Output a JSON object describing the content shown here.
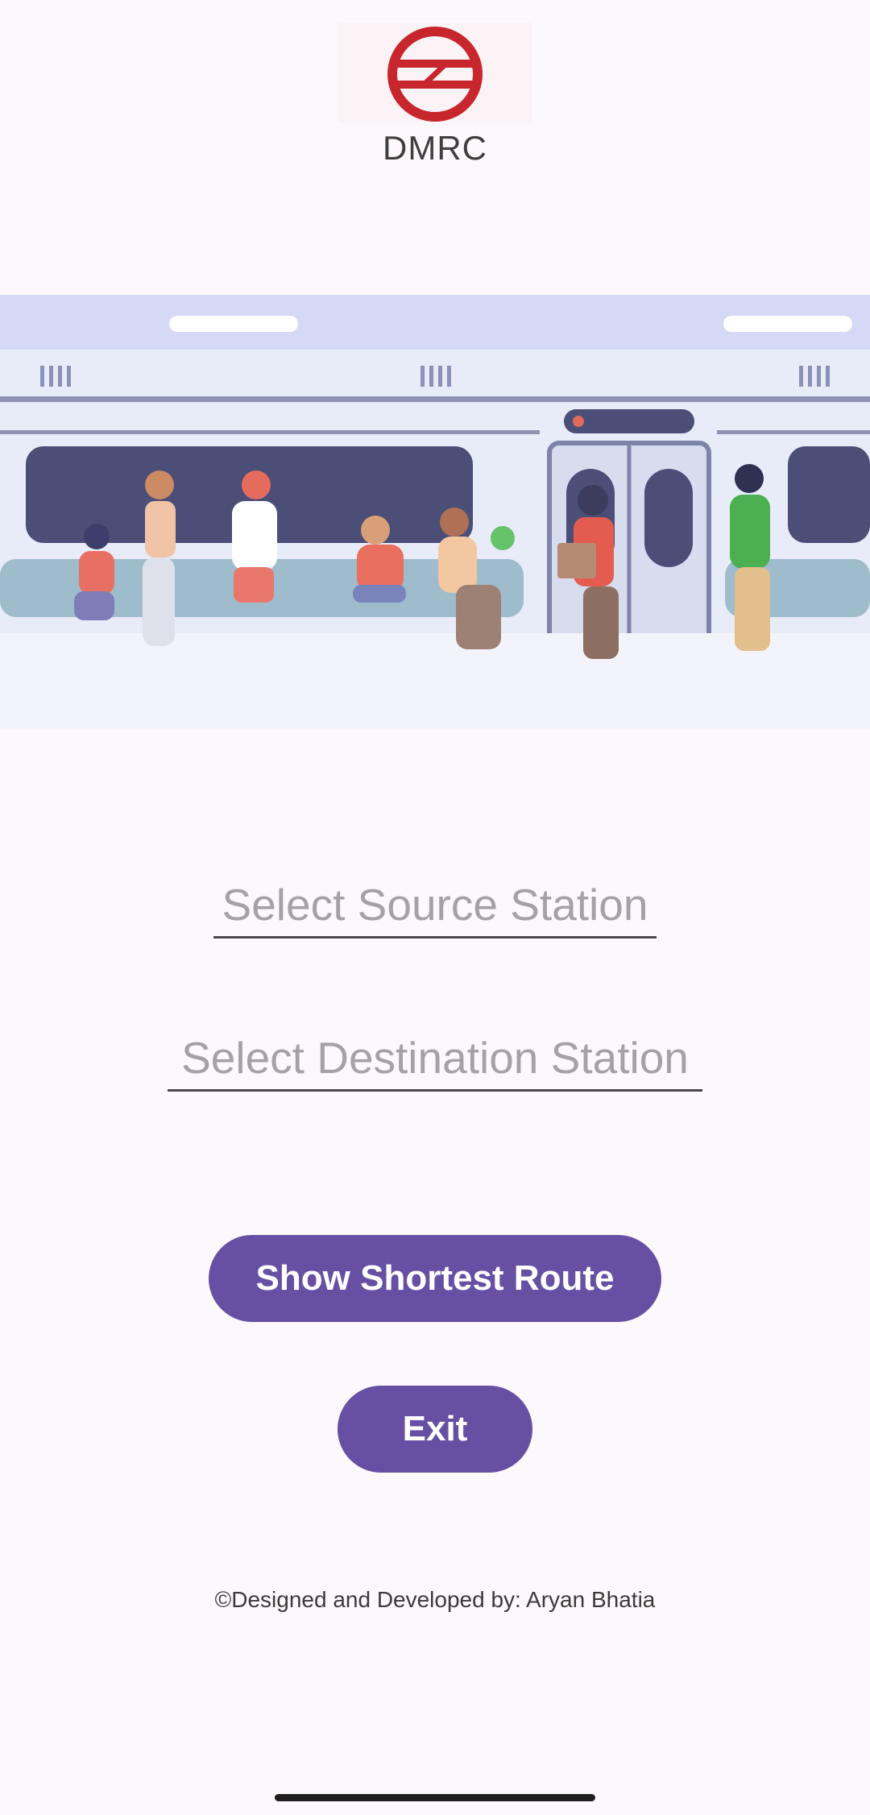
{
  "app": {
    "brand": "DMRC",
    "logo_icon": "dmrc-logo-icon",
    "hero_image": "metro-passengers-illustration"
  },
  "form": {
    "source_placeholder": "Select Source Station",
    "destination_placeholder": "Select Destination Station"
  },
  "actions": {
    "route_label": "Show Shortest Route",
    "exit_label": "Exit"
  },
  "footer": {
    "credit": "©Designed and Developed by: Aryan Bhatia"
  },
  "theme": {
    "accent": "#6750a4",
    "logo_red": "#c8262d",
    "background": "#fdf8fb"
  }
}
